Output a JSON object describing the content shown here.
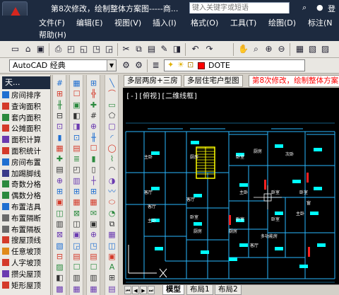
{
  "titlebar": {
    "title": "第8次修改，绘制整体方案图-----商...",
    "search_placeholder": "键入关键字或短语",
    "login_label": "登"
  },
  "menu": {
    "items": [
      "文件(F)",
      "编辑(E)",
      "视图(V)",
      "插入(I)",
      "格式(O)",
      "工具(T)",
      "绘图(D)",
      "标注(N",
      "帮助(H)"
    ]
  },
  "toolbar2": {
    "workspace": "AutoCAD 经典",
    "layer_label": "DOTE"
  },
  "tabs": {
    "items": [
      "多层两房+三房",
      "多层住宅户型图",
      "第8次修改，绘制整体方案图"
    ]
  },
  "canvas": {
    "view_label": "[-][俯视][二维线框]"
  },
  "left_palette": {
    "title": "天...",
    "items": [
      {
        "label": "房间排序",
        "color": "#1f6fd1"
      },
      {
        "label": "查询面积",
        "color": "#d43a2a"
      },
      {
        "label": "套内面积",
        "color": "#2b8a3e"
      },
      {
        "label": "公摊面积",
        "color": "#d43a2a"
      },
      {
        "label": "面积计算",
        "color": "#6a3ab0"
      },
      {
        "label": "面积统计",
        "color": "#d43a2a"
      },
      {
        "label": "房间布置",
        "color": "#1f6fd1"
      },
      {
        "label": "加踢脚线",
        "color": "#3a3a8a"
      },
      {
        "label": "奇数分格",
        "color": "#2b8a3e"
      },
      {
        "label": "偶数分格",
        "color": "#2b8a3e"
      },
      {
        "label": "布置洁具",
        "color": "#1f6fd1"
      },
      {
        "label": "布置隔断",
        "color": "#6a6a6a"
      },
      {
        "label": "布置隔板",
        "color": "#6a6a6a"
      },
      {
        "label": "搜屋顶线",
        "color": "#d43a2a"
      },
      {
        "label": "任意坡顶",
        "color": "#e08a1a"
      },
      {
        "label": "人字坡顶",
        "color": "#d43a2a"
      },
      {
        "label": "攒尖屋顶",
        "color": "#6a3ab0"
      },
      {
        "label": "矩形屋顶",
        "color": "#d43a2a"
      }
    ]
  },
  "layout_tabs": [
    "模型",
    "布局1",
    "布局2"
  ],
  "rooms": [
    "主卧",
    "厨房",
    "卧室",
    "厨房",
    "次卧",
    "客厅",
    "客厅",
    "客厅",
    "主卧",
    "卧室",
    "卧室",
    "卧室",
    "主卧",
    "卧室",
    "卧室",
    "主卧",
    "厨房",
    "厨房",
    "窗",
    "客厅",
    "多功能房"
  ],
  "colors": {
    "titlebar": "#1d2a3f",
    "cad_line": "#2ab7ff",
    "cad_furniture": "#00ffff",
    "cad_stair": "#ffff00",
    "cad_red": "#ff2020"
  }
}
